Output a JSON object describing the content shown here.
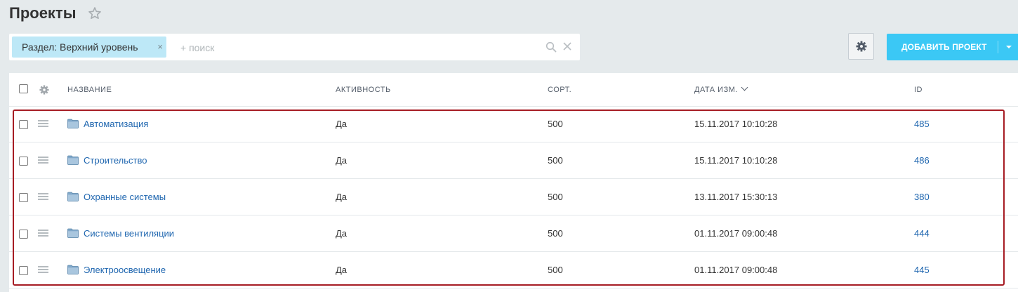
{
  "page": {
    "title": "Проекты"
  },
  "filter": {
    "chip_label": "Раздел: Верхний уровень",
    "chip_close": "×",
    "search_placeholder": "+ поиск"
  },
  "toolbar": {
    "add_label": "ДОБАВИТЬ ПРОЕКТ"
  },
  "colors": {
    "accent": "#3bc8f5",
    "link": "#2067b0",
    "highlight_border": "#a61c24",
    "chip_bg": "#bde8f7"
  },
  "grid": {
    "columns": {
      "name": "НАЗВАНИЕ",
      "active": "АКТИВНОСТЬ",
      "sort": "СОРТ.",
      "date": "ДАТА ИЗМ.",
      "id": "ID"
    },
    "rows": [
      {
        "name": "Автоматизация",
        "active": "Да",
        "sort": "500",
        "date": "15.11.2017 10:10:28",
        "id": "485"
      },
      {
        "name": "Строительство",
        "active": "Да",
        "sort": "500",
        "date": "15.11.2017 10:10:28",
        "id": "486"
      },
      {
        "name": "Охранные системы",
        "active": "Да",
        "sort": "500",
        "date": "13.11.2017 15:30:13",
        "id": "380"
      },
      {
        "name": "Системы вентиляции",
        "active": "Да",
        "sort": "500",
        "date": "01.11.2017 09:00:48",
        "id": "444"
      },
      {
        "name": "Электроосвещение",
        "active": "Да",
        "sort": "500",
        "date": "01.11.2017 09:00:48",
        "id": "445"
      }
    ]
  }
}
